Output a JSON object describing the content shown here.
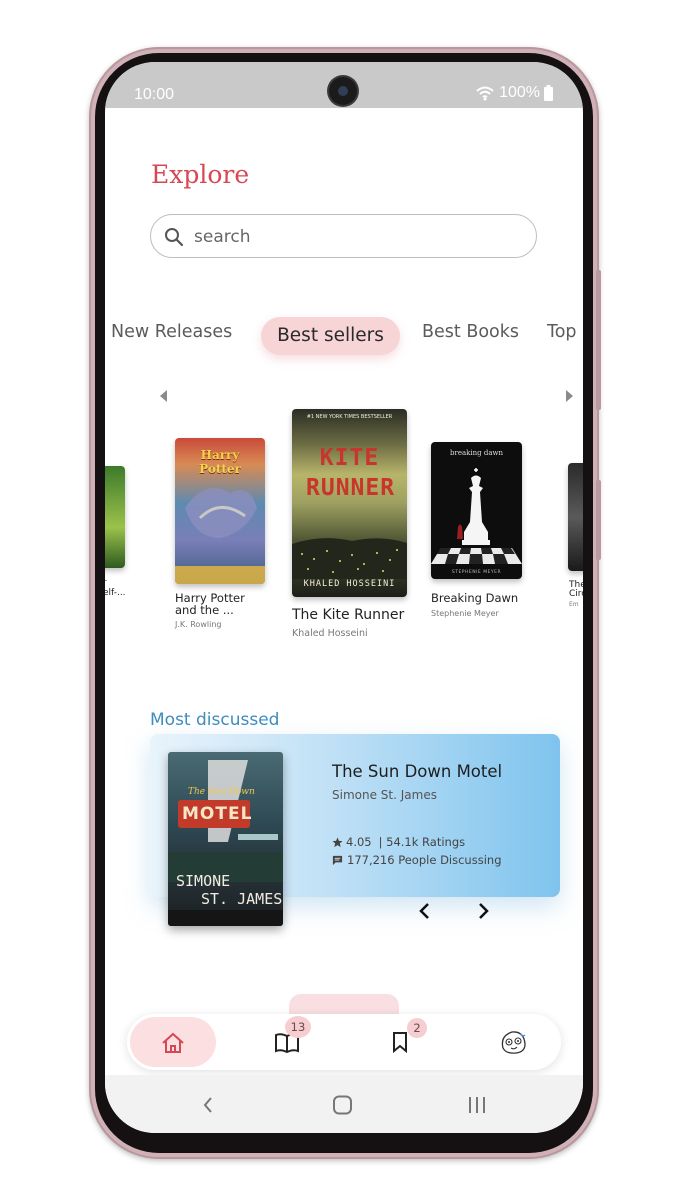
{
  "status_bar": {
    "time": "10:00",
    "battery": "100%"
  },
  "page": {
    "title": "Explore"
  },
  "search": {
    "placeholder": "search"
  },
  "tabs": [
    {
      "label": "New Releases"
    },
    {
      "label": "Best sellers",
      "active": true
    },
    {
      "label": "Best Books"
    },
    {
      "label": "Top"
    }
  ],
  "books": [
    {
      "title_lines": [
        "r",
        "elf-..."
      ],
      "author": "",
      "partial": true
    },
    {
      "title_lines": [
        "Harry Potter",
        "and the ..."
      ],
      "author": "J.K. Rowling",
      "cover_text": "Harry Potter"
    },
    {
      "title_lines": [
        "The Kite Runner"
      ],
      "author": "Khaled Hosseini",
      "cover_text": "KITE RUNNER",
      "cover_top": "#1 NEW YORK TIMES BESTSELLER",
      "cover_author": "KHALED HOSSEINI"
    },
    {
      "title_lines": [
        "Breaking Dawn"
      ],
      "author": "Stephenie Meyer",
      "cover_text": "breaking dawn",
      "cover_author": "STEPHENIE MEYER"
    },
    {
      "title_lines": [
        "The",
        "Circ"
      ],
      "author": "Em",
      "partial": true
    }
  ],
  "most_discussed": {
    "heading": "Most discussed",
    "book_title": "The Sun Down Motel",
    "author": "Simone St. James",
    "rating": "4.05",
    "ratings_count": "| 54.1k Ratings",
    "discussing": "177,216 People Discussing",
    "cover_text": [
      "The Sun Down",
      "MOTEL",
      "SIMONE",
      "ST. JAMES"
    ]
  },
  "bottom_nav": {
    "items": [
      {
        "icon": "home-icon",
        "active": true
      },
      {
        "icon": "book-icon",
        "badge": "13"
      },
      {
        "icon": "bookmark-icon",
        "badge": "2"
      },
      {
        "icon": "avatar-icon"
      }
    ]
  },
  "colors": {
    "accent": "#d64853",
    "pill": "#f7d4d6",
    "link_blue": "#3f8cc0",
    "card_gradient_end": "#7fc4ee"
  }
}
